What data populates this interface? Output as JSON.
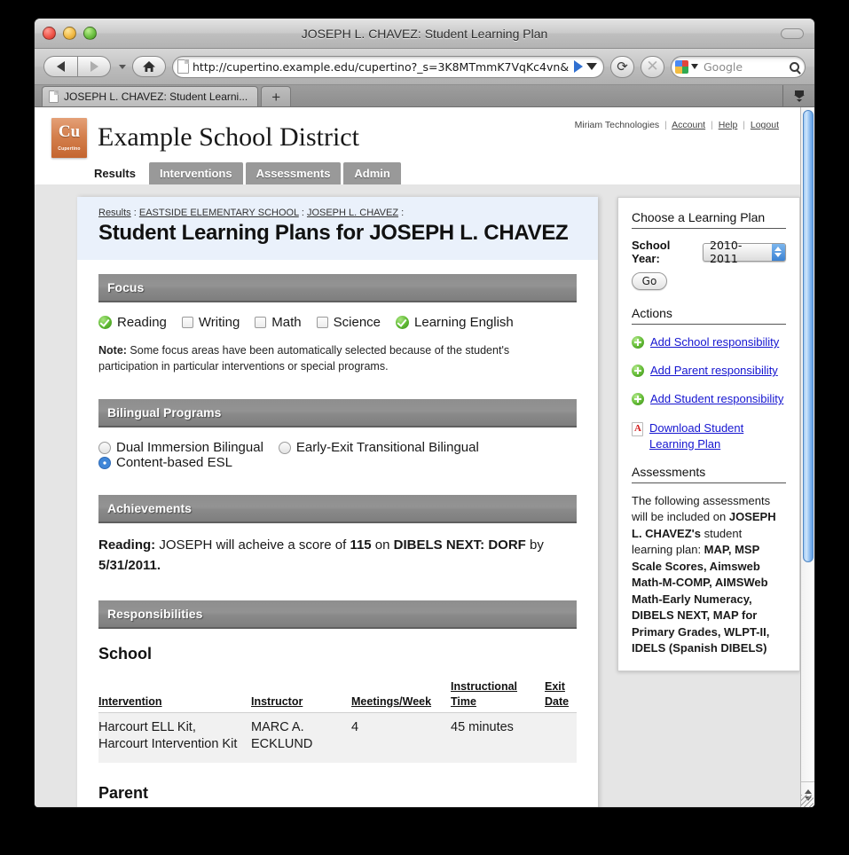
{
  "browser": {
    "window_title": "JOSEPH L. CHAVEZ: Student Learning Plan",
    "url": "http://cupertino.example.edu/cupertino?_s=3K8MTmmK7VqKc4vn&",
    "search_placeholder": "Google",
    "tab_title": "JOSEPH L. CHAVEZ: Student Learni...",
    "new_tab_label": "+",
    "reload_glyph": "⟳",
    "stop_glyph": "✕",
    "icons": {
      "back": "back-arrow-icon",
      "forward": "forward-arrow-icon",
      "home": "home-icon",
      "reload": "reload-icon",
      "stop": "stop-icon",
      "search": "search-icon",
      "downloads": "downloads-icon"
    }
  },
  "site": {
    "logo_abbr": "Cu",
    "logo_caption": "Cupertino",
    "title": "Example School District",
    "account": {
      "org": "Miriam Technologies",
      "links": [
        "Account",
        "Help",
        "Logout"
      ],
      "separator": "|"
    },
    "nav_tabs": [
      {
        "label": "Results",
        "active": true
      },
      {
        "label": "Interventions",
        "active": false
      },
      {
        "label": "Assessments",
        "active": false
      },
      {
        "label": "Admin",
        "active": false
      }
    ]
  },
  "page": {
    "breadcrumb": {
      "root": "Results",
      "sep": " : ",
      "school": "EASTSIDE ELEMENTARY SCHOOL",
      "student": "JOSEPH L. CHAVEZ",
      "trailing": " :"
    },
    "title": "Student Learning Plans for JOSEPH L. CHAVEZ",
    "focus": {
      "heading": "Focus",
      "options": [
        {
          "label": "Reading",
          "checked": true
        },
        {
          "label": "Writing",
          "checked": false
        },
        {
          "label": "Math",
          "checked": false
        },
        {
          "label": "Science",
          "checked": false
        },
        {
          "label": "Learning English",
          "checked": true
        }
      ],
      "note_label": "Note:",
      "note_text": " Some focus areas have been automatically selected because of the student's participation in particular interventions or special programs."
    },
    "bilingual": {
      "heading": "Bilingual Programs",
      "options": [
        {
          "label": "Dual Immersion Bilingual",
          "selected": false
        },
        {
          "label": "Early-Exit Transitional Bilingual",
          "selected": false
        },
        {
          "label": "Content-based ESL",
          "selected": true
        }
      ]
    },
    "achievements": {
      "heading": "Achievements",
      "subject": "Reading:",
      "text_1": " JOSEPH will acheive a score of ",
      "score": "115",
      "text_2": " on ",
      "assessment": "DIBELS NEXT: DORF",
      "text_3": " by ",
      "date": "5/31/2011",
      "text_4": "."
    },
    "responsibilities": {
      "heading": "Responsibilities",
      "school_heading": "School",
      "parent_heading": "Parent",
      "columns": [
        "Intervention",
        "Instructor",
        "Meetings/Week",
        "Instructional Time",
        "Exit Date"
      ],
      "rows": [
        {
          "intervention": "Harcourt ELL Kit, Harcourt Intervention Kit",
          "instructor": "MARC A. ECKLUND",
          "meetings_per_week": "4",
          "instructional_time": "45 minutes",
          "exit_date": ""
        }
      ]
    }
  },
  "sidebar": {
    "choose_heading": "Choose a Learning Plan",
    "school_year_label": "School Year:",
    "school_year_value": "2010-2011",
    "go_label": "Go",
    "actions_heading": "Actions",
    "actions": [
      {
        "label": "Add School responsibility",
        "icon": "plus-circle-icon"
      },
      {
        "label": "Add Parent responsibility",
        "icon": "plus-circle-icon"
      },
      {
        "label": "Add Student responsibility",
        "icon": "plus-circle-icon"
      },
      {
        "label": "Download Student Learning Plan",
        "icon": "pdf-icon"
      }
    ],
    "assessments_heading": "Assessments",
    "assessments_intro": "The following assessments will be included on ",
    "assessments_student": "JOSEPH L. CHAVEZ's",
    "assessments_mid": " student learning plan: ",
    "assessments_list": "MAP, MSP Scale Scores, Aimsweb Math-M-COMP, AIMSWeb Math-Early Numeracy, DIBELS NEXT, MAP for Primary Grades, WLPT-II, IDELS (Spanish DIBELS)"
  },
  "colors": {
    "accent_blue": "#1515d0",
    "breadcrumb_bg": "#eaf1fb",
    "section_header": "#8e8e8e",
    "logo_orange": "#d4804e",
    "check_green": "#5eb832",
    "radio_blue": "#3f86d8"
  }
}
